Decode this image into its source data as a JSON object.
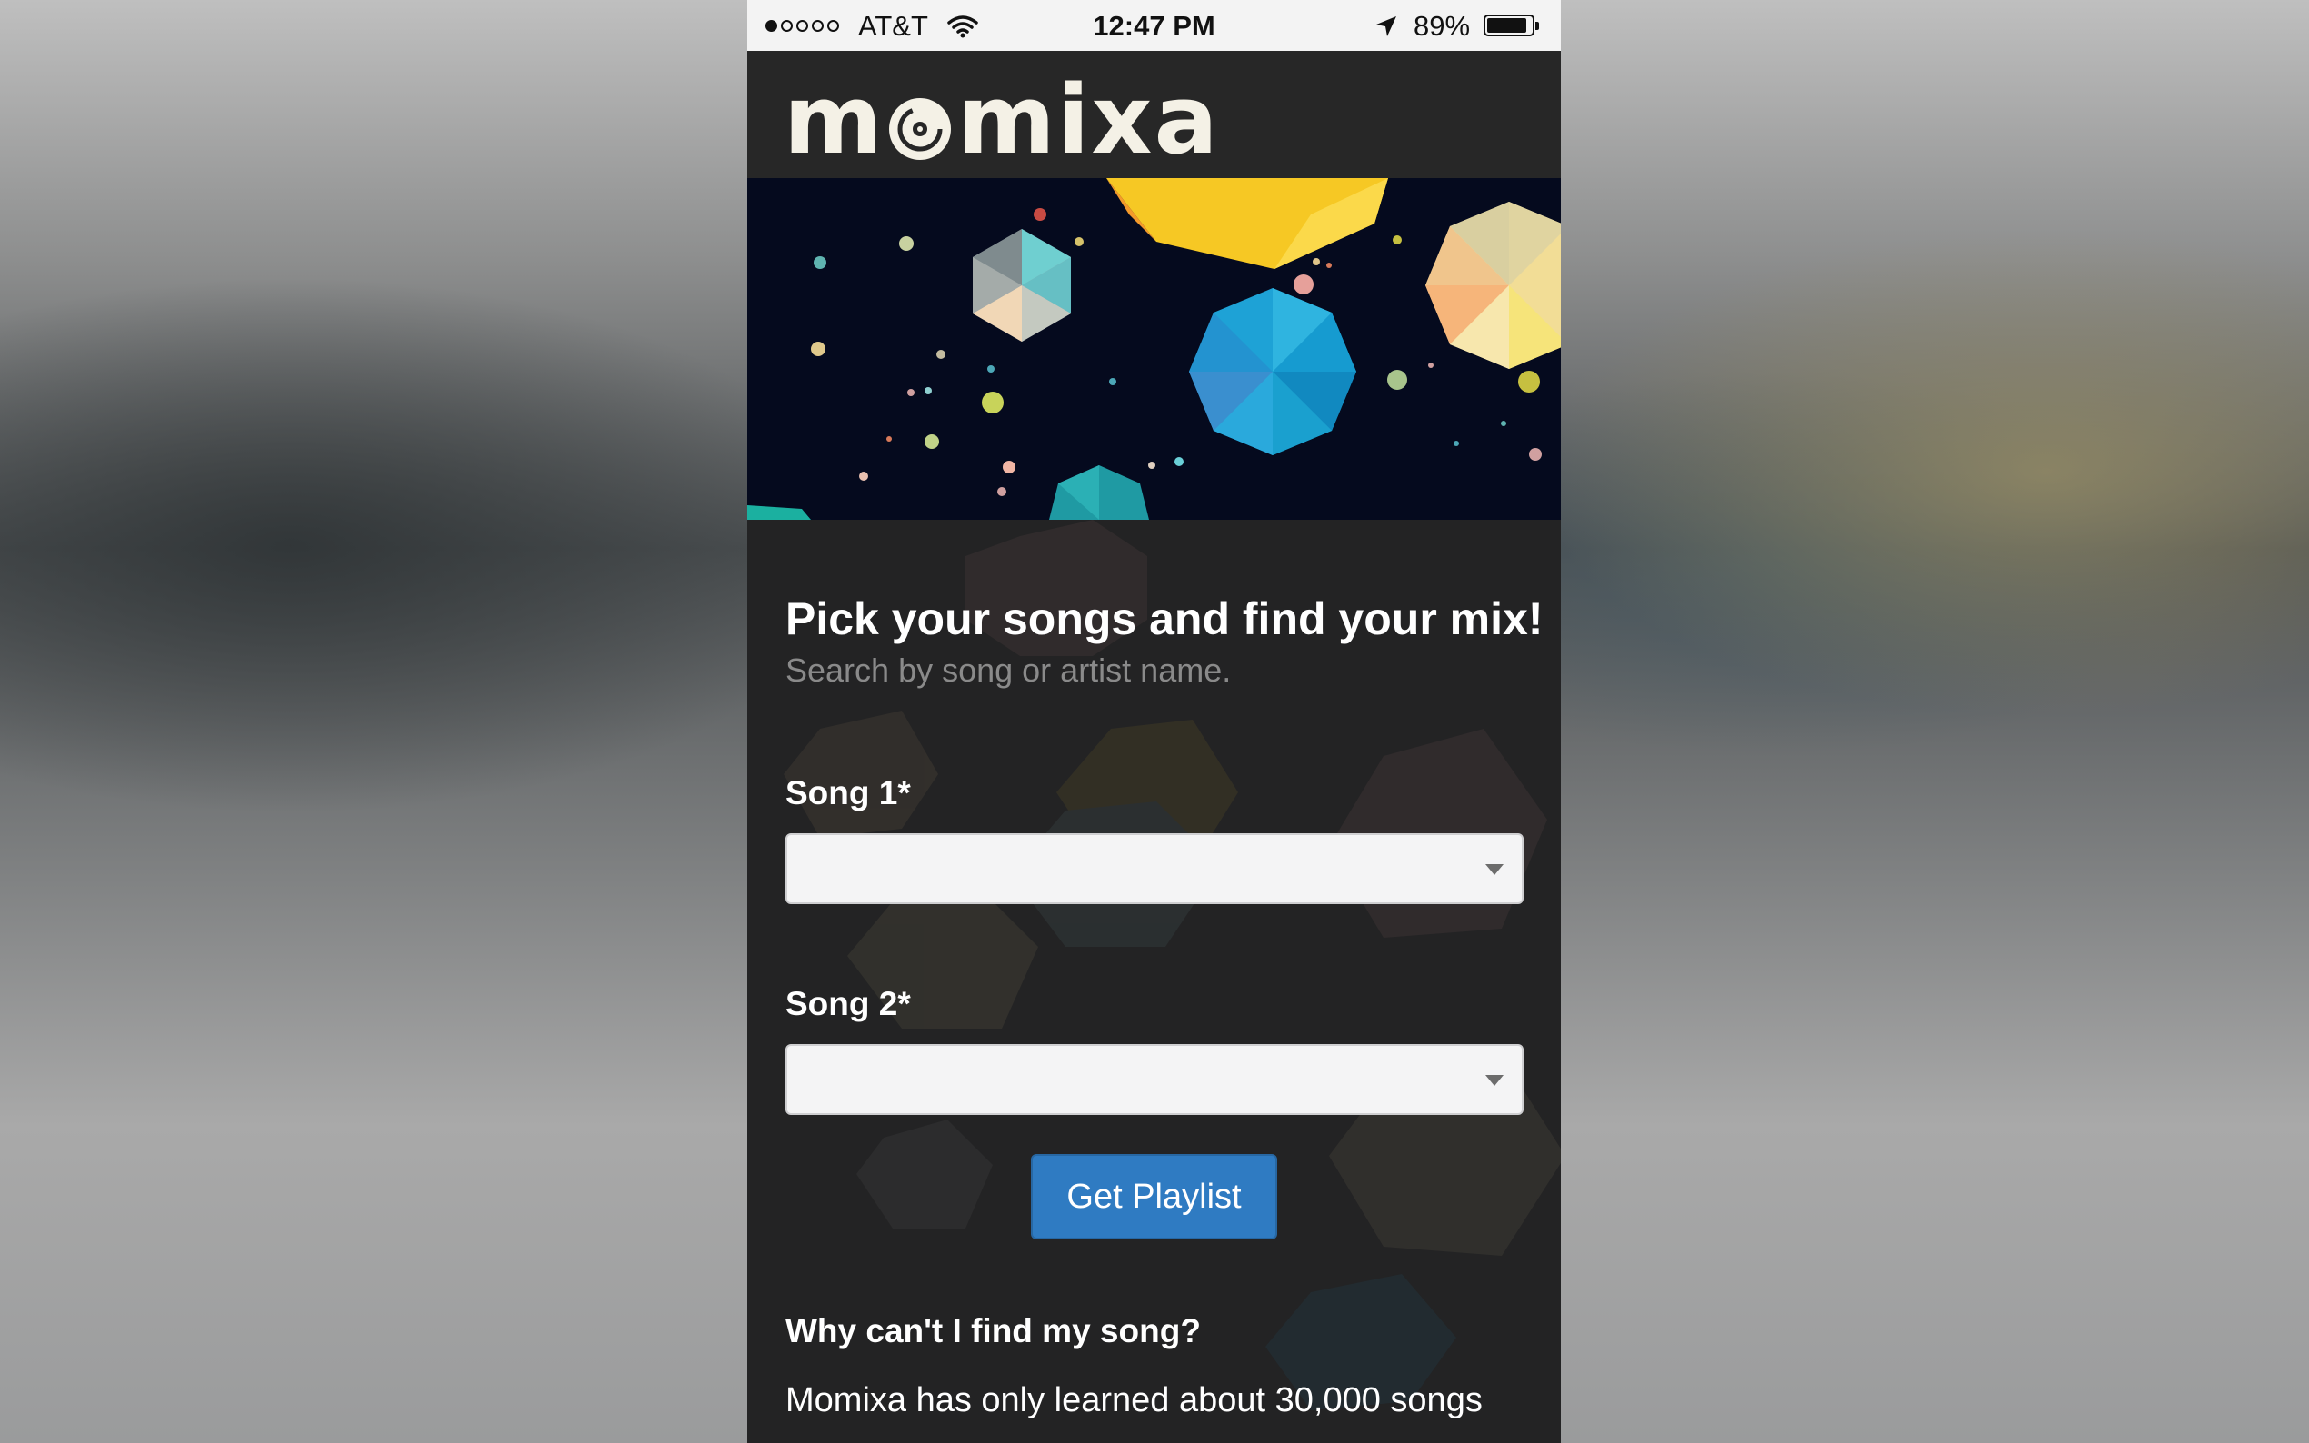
{
  "status_bar": {
    "carrier": "AT&T",
    "time": "12:47 PM",
    "battery": "89%",
    "battery_level": 0.89,
    "signal_bars_filled": 1,
    "signal_bars_total": 5
  },
  "app": {
    "logo_text": "momixa",
    "logo_part_1": "m",
    "logo_part_2": "mixa"
  },
  "form": {
    "headline": "Pick your songs and find your mix!",
    "subtext": "Search by song or artist name.",
    "song1_label": "Song 1*",
    "song1_value": "",
    "song2_label": "Song 2*",
    "song2_value": "",
    "submit_label": "Get Playlist"
  },
  "faq": {
    "title": "Why can't I find my song?",
    "body": "Momixa has only learned about 30,000 songs"
  },
  "colors": {
    "primary_button": "#2f7bc2",
    "page_background": "#232324",
    "banner_background": "#050a1e"
  }
}
